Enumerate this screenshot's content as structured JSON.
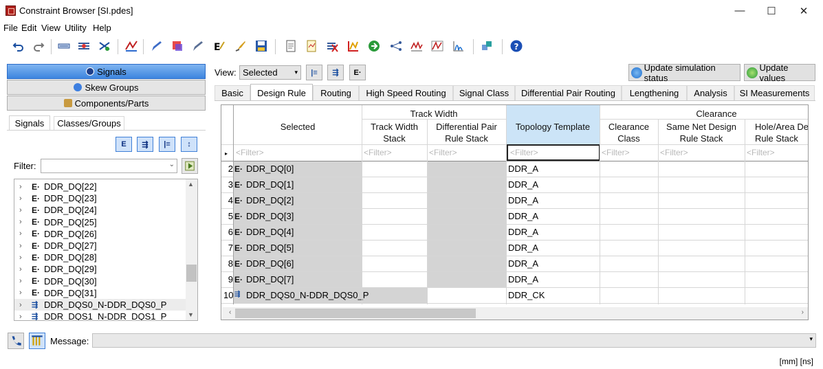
{
  "window": {
    "title": "Constraint Browser [SI.pdes]",
    "minimize": "—",
    "maximize": "☐",
    "close": "✕"
  },
  "menu": [
    "File",
    "Edit",
    "View",
    "Utility",
    "Help"
  ],
  "left": {
    "buttons": [
      "Signals",
      "Skew Groups",
      "Components/Parts"
    ],
    "tabs": [
      "Signals",
      "Classes/Groups"
    ],
    "filter_label": "Filter:",
    "filter_value": "",
    "tree": [
      {
        "label": "DDR_DQ[22]",
        "kind": "net"
      },
      {
        "label": "DDR_DQ[23]",
        "kind": "net"
      },
      {
        "label": "DDR_DQ[24]",
        "kind": "net"
      },
      {
        "label": "DDR_DQ[25]",
        "kind": "net"
      },
      {
        "label": "DDR_DQ[26]",
        "kind": "net"
      },
      {
        "label": "DDR_DQ[27]",
        "kind": "net"
      },
      {
        "label": "DDR_DQ[28]",
        "kind": "net"
      },
      {
        "label": "DDR_DQ[29]",
        "kind": "net"
      },
      {
        "label": "DDR_DQ[30]",
        "kind": "net"
      },
      {
        "label": "DDR_DQ[31]",
        "kind": "net"
      },
      {
        "label": "DDR_DQS0_N-DDR_DQS0_P",
        "kind": "pair"
      },
      {
        "label": "DDR_DQS1_N-DDR_DQS1_P",
        "kind": "pair"
      }
    ]
  },
  "view": {
    "label": "View:",
    "selected": "Selected"
  },
  "actions": {
    "update_sim": "Update simulation status",
    "update_values": "Update values"
  },
  "tabs": [
    "Basic",
    "Design Rule",
    "Routing",
    "High Speed Routing",
    "Signal Class",
    "Differential Pair Routing",
    "Lengthening",
    "Analysis",
    "SI Measurements"
  ],
  "grid": {
    "group_headers": {
      "track_width": "Track Width",
      "clearance": "Clearance"
    },
    "columns": {
      "selected": "Selected",
      "tw_stack": "Track Width\nStack",
      "dp_stack": "Differential Pair\nRule Stack",
      "topology": "Topology Template",
      "clr_class": "Clearance\nClass",
      "same_net": "Same Net Design\nRule Stack",
      "hole_area": "Hole/Area De\nRule Stack"
    },
    "filter_placeholder": "<Filter>",
    "rows": [
      {
        "num": "2",
        "name": "DDR_DQ[0]",
        "topology": "DDR_A",
        "kind": "net"
      },
      {
        "num": "3",
        "name": "DDR_DQ[1]",
        "topology": "DDR_A",
        "kind": "net"
      },
      {
        "num": "4",
        "name": "DDR_DQ[2]",
        "topology": "DDR_A",
        "kind": "net"
      },
      {
        "num": "5",
        "name": "DDR_DQ[3]",
        "topology": "DDR_A",
        "kind": "net"
      },
      {
        "num": "6",
        "name": "DDR_DQ[4]",
        "topology": "DDR_A",
        "kind": "net"
      },
      {
        "num": "7",
        "name": "DDR_DQ[5]",
        "topology": "DDR_A",
        "kind": "net"
      },
      {
        "num": "8",
        "name": "DDR_DQ[6]",
        "topology": "DDR_A",
        "kind": "net"
      },
      {
        "num": "9",
        "name": "DDR_DQ[7]",
        "topology": "DDR_A",
        "kind": "net"
      },
      {
        "num": "10",
        "name": "DDR_DQS0_N-DDR_DQS0_P",
        "topology": "DDR_CK",
        "kind": "pair"
      }
    ]
  },
  "status": {
    "message_label": "Message:",
    "message": "",
    "units": "[mm]  [ns]"
  },
  "colors": {
    "accent": "#3d85df",
    "selected_header": "#cce4f7",
    "locked_cell": "#d4d4d4"
  }
}
